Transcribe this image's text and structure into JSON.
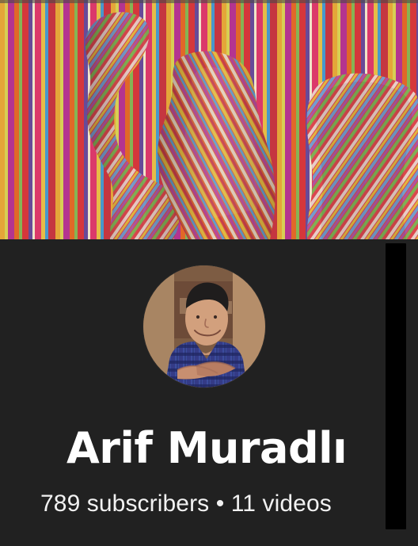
{
  "channel": {
    "banner_icon": "channel-banner-image",
    "avatar_icon": "profile-photo",
    "name": "Arif Muradlı",
    "stats": "789 subscribers • 11 videos"
  },
  "colors": {
    "background": "#212121",
    "text_primary": "#ffffff",
    "text_secondary": "#f2f2f2",
    "scrollbar": "#000000"
  }
}
